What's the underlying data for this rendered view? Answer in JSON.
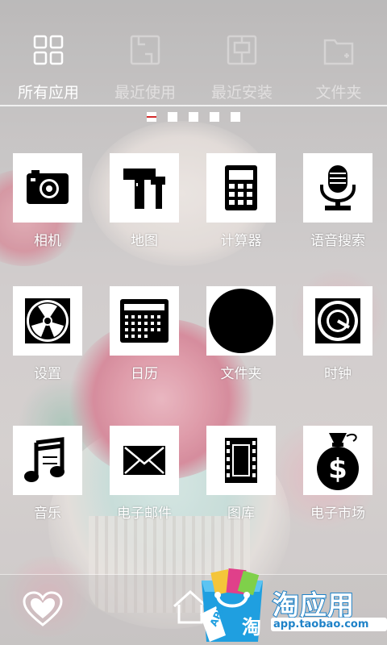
{
  "tabs": [
    {
      "label": "所有应用",
      "icon": "grid-icon",
      "active": true
    },
    {
      "label": "最近使用",
      "icon": "recent-icon",
      "active": false
    },
    {
      "label": "最近安装",
      "icon": "installed-icon",
      "active": false
    },
    {
      "label": "文件夹",
      "icon": "folder-icon",
      "active": false
    }
  ],
  "pager": {
    "total": 5,
    "current": 0
  },
  "apps": [
    {
      "label": "相机",
      "icon": "camera-icon"
    },
    {
      "label": "地图",
      "icon": "map-icon"
    },
    {
      "label": "计算器",
      "icon": "calculator-icon"
    },
    {
      "label": "语音搜索",
      "icon": "microphone-icon"
    },
    {
      "label": "设置",
      "icon": "settings-icon"
    },
    {
      "label": "日历",
      "icon": "calendar-icon"
    },
    {
      "label": "文件夹",
      "icon": "folder-blob-icon"
    },
    {
      "label": "时钟",
      "icon": "clock-icon"
    },
    {
      "label": "音乐",
      "icon": "music-icon"
    },
    {
      "label": "电子邮件",
      "icon": "mail-icon"
    },
    {
      "label": "图库",
      "icon": "film-icon"
    },
    {
      "label": "电子市场",
      "icon": "money-bag-icon"
    }
  ],
  "dock": {
    "left_icon": "heart-icon",
    "center_icon": "home-icon"
  },
  "watermark": {
    "brand": "淘应用",
    "url": "app.taobao.com",
    "bag_text": "APP",
    "bag_char": "淘"
  },
  "colors": {
    "accent": "#d22b2b",
    "brand_blue": "#1e82c8"
  }
}
